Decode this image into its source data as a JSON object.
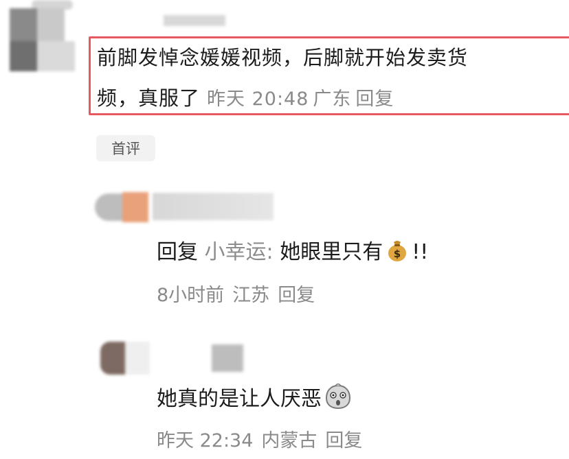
{
  "main_comment": {
    "line1": "前脚发悼念媛媛视频，后脚就开始发卖货",
    "line2": "频，真服了",
    "time": "昨天 20:48",
    "location": "广东",
    "reply_label": "回复",
    "highlight_color": "#e8575c"
  },
  "first_comment_badge": "首评",
  "replies": [
    {
      "prefix": "回复",
      "reply_to": "小幸运:",
      "text": "她眼里只有",
      "emoji": "money-bag-icon",
      "suffix": "!!",
      "time": "8小时前",
      "location": "江苏",
      "reply_label": "回复"
    },
    {
      "text": "她真的是让人厌恶",
      "emoji": "shocked-face-icon",
      "time": "昨天 22:34",
      "location": "内蒙古",
      "reply_label": "回复"
    }
  ]
}
